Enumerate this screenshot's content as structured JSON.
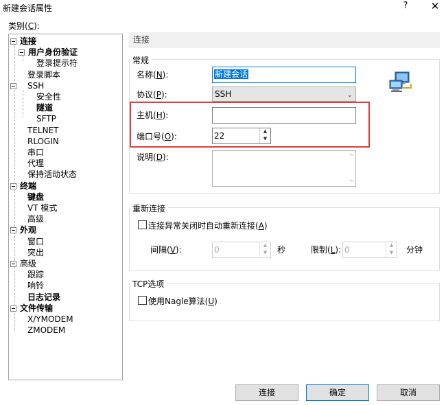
{
  "window": {
    "title": "新建会话属性",
    "help_glyph": "?",
    "close_glyph": "✕"
  },
  "category": {
    "label": "类别(",
    "mnemonic": "C",
    "label_end": "):"
  },
  "tree": [
    {
      "label": "连接",
      "bold": true
    },
    {
      "label": "用户身份验证",
      "bold": true
    },
    {
      "label": "登录提示符",
      "bold": false
    },
    {
      "label": "登录脚本",
      "bold": false
    },
    {
      "label": "SSH",
      "bold": false
    },
    {
      "label": "安全性",
      "bold": false
    },
    {
      "label": "隧道",
      "bold": true
    },
    {
      "label": "SFTP",
      "bold": false
    },
    {
      "label": "TELNET",
      "bold": false
    },
    {
      "label": "RLOGIN",
      "bold": false
    },
    {
      "label": "串口",
      "bold": false
    },
    {
      "label": "代理",
      "bold": false
    },
    {
      "label": "保持活动状态",
      "bold": false
    },
    {
      "label": "终端",
      "bold": true
    },
    {
      "label": "键盘",
      "bold": true
    },
    {
      "label": "VT 模式",
      "bold": false
    },
    {
      "label": "高级",
      "bold": false
    },
    {
      "label": "外观",
      "bold": true
    },
    {
      "label": "窗口",
      "bold": false
    },
    {
      "label": "突出",
      "bold": false
    },
    {
      "label": "高级",
      "bold": false
    },
    {
      "label": "跟踪",
      "bold": false
    },
    {
      "label": "响铃",
      "bold": false
    },
    {
      "label": "日志记录",
      "bold": true
    },
    {
      "label": "文件传输",
      "bold": true
    },
    {
      "label": "X/YMODEM",
      "bold": false
    },
    {
      "label": "ZMODEM",
      "bold": false
    }
  ],
  "section_header": "连接",
  "general": {
    "title": "常规",
    "name_label": "名称(",
    "name_mnemonic": "N",
    "name_label_end": "):",
    "name_value": "新建会话",
    "protocol_label": "协议(",
    "protocol_mnemonic": "P",
    "protocol_label_end": "):",
    "protocol_value": "SSH",
    "host_label": "主机(",
    "host_mnemonic": "H",
    "host_label_end": "):",
    "host_value": "",
    "port_label": "端口号(",
    "port_mnemonic": "O",
    "port_label_end": "):",
    "port_value": "22",
    "desc_label": "说明(",
    "desc_mnemonic": "D",
    "desc_label_end": "):",
    "desc_value": ""
  },
  "reconnect": {
    "title": "重新连接",
    "checkbox_label": "连接异常关闭时自动重新连接(",
    "checkbox_mnemonic": "A",
    "checkbox_label_end": ")",
    "checked": false,
    "interval_label": "间隔(",
    "interval_mnemonic": "V",
    "interval_label_end": "):",
    "interval_value": "0",
    "interval_unit": "秒",
    "limit_label": "限制(",
    "limit_mnemonic": "L",
    "limit_label_end": "):",
    "limit_value": "0",
    "limit_unit": "分钟"
  },
  "tcp": {
    "title": "TCP选项",
    "checkbox_label": "使用Nagle算法(",
    "checkbox_mnemonic": "U",
    "checkbox_label_end": ")",
    "checked": false
  },
  "buttons": {
    "connect": "连接",
    "ok": "确定",
    "cancel": "取消"
  },
  "colors": {
    "highlight_border": "#e23b3b",
    "selection": "#0078d7"
  }
}
